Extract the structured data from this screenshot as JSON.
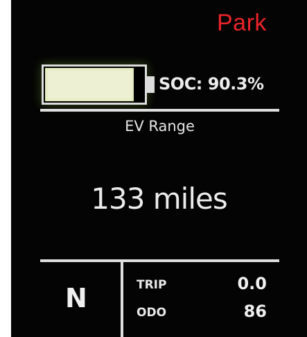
{
  "status": {
    "drive_mode": "Park",
    "drive_mode_color": "#e8242a"
  },
  "battery": {
    "icon": "battery-icon",
    "charge_fraction": 0.903,
    "soc_label": "SOC: 90.3%",
    "fill_color": "#eef0d4"
  },
  "range": {
    "title": "EV Range",
    "value": "133 miles"
  },
  "gear": {
    "current": "N"
  },
  "odometer": {
    "trip_label": "TRIP",
    "trip_value": "0.0",
    "odo_label": "ODO",
    "odo_value": "86"
  }
}
